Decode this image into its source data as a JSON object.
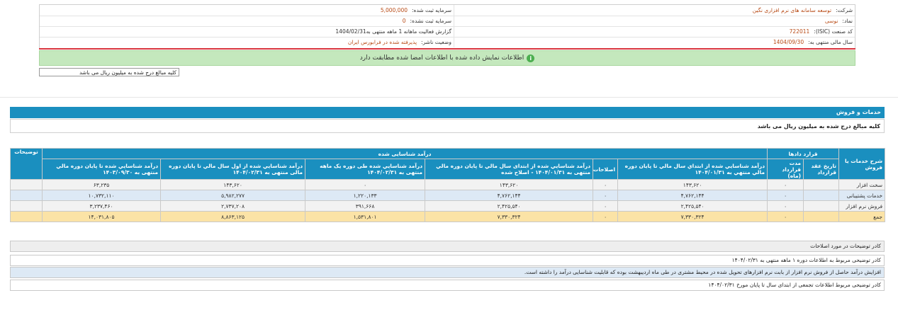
{
  "company_info": {
    "company_label": "شرکت:",
    "company_value": "توسعه سامانه های نرم افزاری نگین",
    "symbol_label": "نماد:",
    "symbol_value": "نوسی",
    "isic_label": "کد صنعت (ISIC):",
    "isic_value": "722011",
    "fiscal_label": "سال مالی منتهی به:",
    "fiscal_value": "1404/09/30",
    "registered_capital_label": "سرمایه ثبت شده:",
    "registered_capital_value": "5,000,000",
    "unregistered_capital_label": "سرمایه ثبت نشده:",
    "unregistered_capital_value": "0",
    "report_label": "گزارش فعالیت ماهانه 1 ماهه منتهی به",
    "report_value": "1404/02/31",
    "publisher_label": "وضعیت ناشر:",
    "publisher_value": "پذیرفته شده در فرابورس ایران"
  },
  "banner": {
    "text": "اطلاعات نمایش داده شده با اطلاعات امضا شده مطابقت دارد",
    "icon": "info-icon"
  },
  "units_select": {
    "value": "کلیه مبالغ درج شده به میلیون ریال می باشد"
  },
  "section": {
    "title": "خدمات و فروش",
    "note": "کلیه مبالغ درج شده به میلیون ریال می باشد"
  },
  "table": {
    "headers": {
      "service_desc": "شرح خدمات یا فروش",
      "contracts_group": "قرارد دادها",
      "contract_date": "تاریخ عقد قرارداد",
      "contract_duration": "مدت قرارداد (ماه)",
      "recognized_group": "درآمد شناسایی شده",
      "cum_prev": "درآمد شناسايي شده از ابتداي سال مالي تا پايان دوره مالي منتهي به ۱۴۰۴/۰۱/۳۱",
      "corrections": "اصلاحات",
      "cum_prev_corrected": "درآمد شناسايي شده از ابتدای سال مالي تا پايان دوره مالي منتهی به ۱۴۰۴/۰۱/۳۱ - اصلاح شده",
      "month": "درآمد شناسايي شده طی دوره یک ماهه منتهی به ۱۴۰۴/۰۲/۳۱",
      "cum_current": "درآمد شناسايي شده از اول سال مالي تا پايان دوره مالی منتهی به ۱۴۰۴/۰۲/۳۱",
      "prev_year": "درآمد شناسايي شده تا پايان دوره مالي منتهی به ۱۴۰۳/۰۹/۳۰",
      "remarks": "توضیحات"
    },
    "rows": [
      {
        "desc": "سخت افزار",
        "date": "",
        "duration": "۰",
        "cum_prev": "۱۴۳,۶۲۰",
        "corrections": "۰",
        "cum_prev_corrected": "۱۴۳,۶۲۰",
        "month": "۰",
        "cum_current": "۱۴۳,۶۲۰",
        "prev_year": "۶۳,۲۳۵",
        "remarks": ""
      },
      {
        "desc": "خدمات پشتیبانی",
        "date": "",
        "duration": "۰",
        "cum_prev": "۴,۷۶۲,۱۴۴",
        "corrections": "۰",
        "cum_prev_corrected": "۴,۷۶۲,۱۴۴",
        "month": "۱,۲۲۰,۱۳۳",
        "cum_current": "۵,۹۸۲,۲۷۷",
        "prev_year": "۱۰,۷۳۲,۱۱۰",
        "remarks": ""
      },
      {
        "desc": "فروش نرم افزار",
        "date": "",
        "duration": "۰",
        "cum_prev": "۲,۴۲۵,۵۴۰",
        "corrections": "۰",
        "cum_prev_corrected": "۲,۴۲۵,۵۴۰",
        "month": "۳۹۱,۶۶۸",
        "cum_current": "۲,۷۳۷,۲۰۸",
        "prev_year": "۳,۲۳۷,۴۶۰",
        "remarks": ""
      }
    ],
    "total": {
      "label": "جمع",
      "duration": "۰",
      "cum_prev": "۷,۳۳۰,۳۲۴",
      "corrections": "۰",
      "cum_prev_corrected": "۷,۳۳۰,۳۲۴",
      "month": "۱,۵۳۱,۸۰۱",
      "cum_current": "۸,۸۶۳,۱۲۵",
      "prev_year": "۱۴,۰۳۱,۸۰۵",
      "remarks": ""
    }
  },
  "notes": {
    "n1": "کادر توضیحات در مورد اصلاحات",
    "n2": "کادر توضیحی مربوط به اطلاعات دوره ۱ ماهه منتهی به ۱۴۰۴/۰۲/۳۱",
    "n3": "افزایش درآمد حاصل از فروش نرم افزار از بابت نرم افزارهای تحویل شده در محیط مشتری در طی ماه اردیبهشت بوده که قابلیت شناسایی درآمد را داشته است.",
    "n4": "کادر توضیحی مربوط اطلاعات تجمعی از ابتدای سال تا پایان مورخ ۱۴۰۴/۰۲/۳۱"
  }
}
